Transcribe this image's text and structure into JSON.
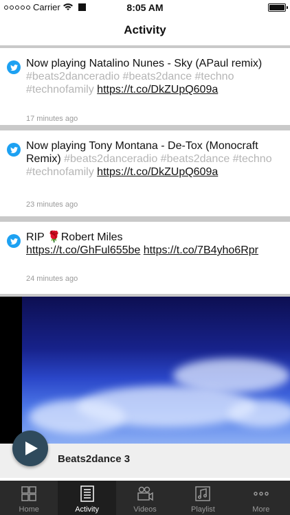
{
  "status_bar": {
    "carrier": "Carrier",
    "time": "8:05 AM"
  },
  "nav": {
    "title": "Activity"
  },
  "feed": {
    "items": [
      {
        "text": "Now playing Natalino Nunes - Sky (APaul remix)",
        "hashtags": "#beats2danceradio #beats2dance #techno #technofamily",
        "link": "https://t.co/DkZUpQ609a",
        "timestamp": "17 minutes ago"
      },
      {
        "text": "Now playing Tony Montana - De-Tox (Monocraft Remix)",
        "hashtags": "#beats2danceradio #beats2dance #techno #technofamily",
        "link": "https://t.co/DkZUpQ609a",
        "timestamp": "23 minutes ago"
      },
      {
        "text": "RIP 🌹Robert Miles",
        "link": "https://t.co/GhFul655be",
        "link2": "https://t.co/7B4yho6Rpr",
        "timestamp": "24 minutes ago"
      }
    ]
  },
  "player": {
    "track_title": "Beats2dance 3",
    "play_icon": "play-icon"
  },
  "tab_bar": {
    "tabs": [
      {
        "label": "Home",
        "icon": "grid-icon"
      },
      {
        "label": "Activity",
        "icon": "list-icon",
        "active": true
      },
      {
        "label": "Videos",
        "icon": "video-camera-icon"
      },
      {
        "label": "Playlist",
        "icon": "music-note-icon"
      },
      {
        "label": "More",
        "icon": "ellipsis-icon"
      }
    ]
  },
  "colors": {
    "twitter_blue": "#1da1f2",
    "tab_bar_bg": "#2a2a2a",
    "hashtag": "#b5b5b5",
    "play_button": "#2f4a5c"
  }
}
